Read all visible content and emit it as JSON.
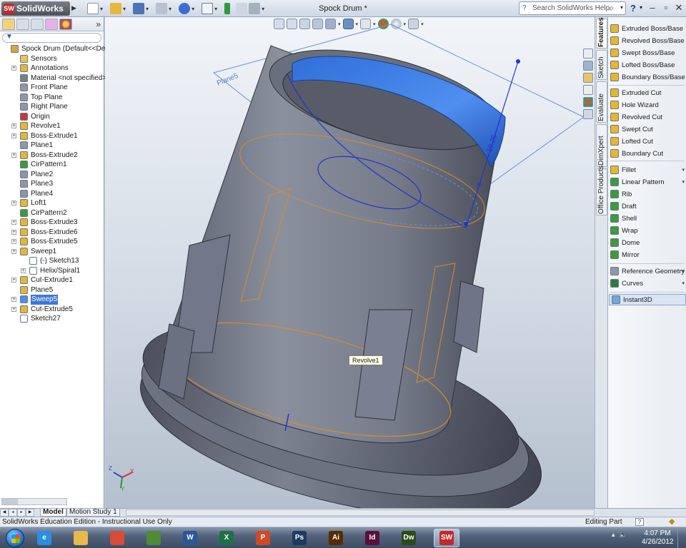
{
  "app": {
    "logo_text": "SolidWorks",
    "logo_badge": "SW",
    "window_title": "Spock Drum *",
    "help_search_placeholder": "Search SolidWorks Help",
    "help_symbol": "?"
  },
  "tree": {
    "more_glyph": "»",
    "items": [
      {
        "label": "Spock Drum  (Default<<Default",
        "icon": "part-icon",
        "indent": 0,
        "expandable": false,
        "selected": false,
        "color": "#d8a73a"
      },
      {
        "label": "Sensors",
        "icon": "sensor-icon",
        "indent": 1,
        "expandable": false,
        "selected": false,
        "color": "#e8c35a"
      },
      {
        "label": "Annotations",
        "icon": "annotation-icon",
        "indent": 1,
        "expandable": true,
        "selected": false,
        "color": "#e0b53d"
      },
      {
        "label": "Material <not specified>",
        "icon": "material-icon",
        "indent": 1,
        "expandable": false,
        "selected": false,
        "color": "#7a7f87"
      },
      {
        "label": "Front Plane",
        "icon": "plane-icon",
        "indent": 1,
        "expandable": false,
        "selected": false,
        "color": "#8d98a6"
      },
      {
        "label": "Top Plane",
        "icon": "plane-icon",
        "indent": 1,
        "expandable": false,
        "selected": false,
        "color": "#8d98a6"
      },
      {
        "label": "Right Plane",
        "icon": "plane-icon",
        "indent": 1,
        "expandable": false,
        "selected": false,
        "color": "#8d98a6"
      },
      {
        "label": "Origin",
        "icon": "origin-icon",
        "indent": 1,
        "expandable": false,
        "selected": false,
        "color": "#c33b3b"
      },
      {
        "label": "Revolve1",
        "icon": "revolve-icon",
        "indent": 1,
        "expandable": true,
        "selected": false,
        "color": "#e5b630"
      },
      {
        "label": "Boss-Extrude1",
        "icon": "extrude-icon",
        "indent": 1,
        "expandable": true,
        "selected": false,
        "color": "#e5b630"
      },
      {
        "label": "Plane1",
        "icon": "plane-icon",
        "indent": 1,
        "expandable": false,
        "selected": false,
        "color": "#8d98a6"
      },
      {
        "label": "Boss-Extrude2",
        "icon": "extrude-icon",
        "indent": 1,
        "expandable": true,
        "selected": false,
        "color": "#e5b630"
      },
      {
        "label": "CirPattern1",
        "icon": "circular-pattern-icon",
        "indent": 1,
        "expandable": false,
        "selected": false,
        "color": "#3d9a3d"
      },
      {
        "label": "Plane2",
        "icon": "plane-icon",
        "indent": 1,
        "expandable": false,
        "selected": false,
        "color": "#8d98a6"
      },
      {
        "label": "Plane3",
        "icon": "plane-icon",
        "indent": 1,
        "expandable": false,
        "selected": false,
        "color": "#8d98a6"
      },
      {
        "label": "Plane4",
        "icon": "plane-icon",
        "indent": 1,
        "expandable": false,
        "selected": false,
        "color": "#8d98a6"
      },
      {
        "label": "Loft1",
        "icon": "loft-icon",
        "indent": 1,
        "expandable": true,
        "selected": false,
        "color": "#e5b630"
      },
      {
        "label": "CirPattern2",
        "icon": "circular-pattern-icon",
        "indent": 1,
        "expandable": false,
        "selected": false,
        "color": "#3d9a3d"
      },
      {
        "label": "Boss-Extrude3",
        "icon": "extrude-icon",
        "indent": 1,
        "expandable": true,
        "selected": false,
        "color": "#e5b630"
      },
      {
        "label": "Boss-Extrude6",
        "icon": "extrude-icon",
        "indent": 1,
        "expandable": true,
        "selected": false,
        "color": "#e5b630"
      },
      {
        "label": "Boss-Extrude5",
        "icon": "extrude-icon",
        "indent": 1,
        "expandable": true,
        "selected": false,
        "color": "#e5b630"
      },
      {
        "label": "Sweep1",
        "icon": "sweep-icon",
        "indent": 1,
        "expandable": true,
        "selected": false,
        "color": "#e5b630"
      },
      {
        "label": "(-) Sketch13",
        "icon": "sketch-icon",
        "indent": 2,
        "expandable": false,
        "selected": false,
        "color": "#ffffff"
      },
      {
        "label": "Helix/Spiral1",
        "icon": "helix-icon",
        "indent": 2,
        "expandable": true,
        "selected": false,
        "color": "#ffffff"
      },
      {
        "label": "Cut-Extrude1",
        "icon": "cut-extrude-icon",
        "indent": 1,
        "expandable": true,
        "selected": false,
        "color": "#e5b630"
      },
      {
        "label": "Plane5",
        "icon": "plane-icon",
        "indent": 1,
        "expandable": false,
        "selected": false,
        "color": "#e0b53d"
      },
      {
        "label": "Sweep5",
        "icon": "sweep-icon",
        "indent": 1,
        "expandable": true,
        "selected": true,
        "color": "#4d8fe0"
      },
      {
        "label": "Cut-Extrude5",
        "icon": "cut-extrude-icon",
        "indent": 1,
        "expandable": true,
        "selected": false,
        "color": "#e5b630"
      },
      {
        "label": "Sketch27",
        "icon": "sketch-icon",
        "indent": 1,
        "expandable": false,
        "selected": false,
        "color": "#ffffff"
      }
    ]
  },
  "viewport": {
    "plane_label": "Plane5",
    "tooltip": "Revolve1",
    "dimension_1": "10.25",
    "dimension_2": "5",
    "triad": {
      "x": "X",
      "y": "Y",
      "z": "Z"
    }
  },
  "taskpane_tabs": [
    "Features",
    "Sketch",
    "Evaluate",
    "DimXpert",
    "Office Products"
  ],
  "features": [
    {
      "label": "Extruded Boss/Base",
      "icon": "extruded-boss-icon",
      "dropdown": false,
      "color": "#e5b630"
    },
    {
      "label": "Revolved Boss/Base",
      "icon": "revolved-boss-icon",
      "dropdown": false,
      "color": "#e5b630"
    },
    {
      "label": "Swept Boss/Base",
      "icon": "swept-boss-icon",
      "dropdown": false,
      "color": "#e5b630"
    },
    {
      "label": "Lofted Boss/Base",
      "icon": "lofted-boss-icon",
      "dropdown": false,
      "color": "#e5b630"
    },
    {
      "label": "Boundary Boss/Base",
      "icon": "boundary-boss-icon",
      "dropdown": false,
      "color": "#e5b630"
    },
    {
      "label": "Extruded Cut",
      "icon": "extruded-cut-icon",
      "dropdown": false,
      "color": "#e5b630"
    },
    {
      "label": "Hole Wizard",
      "icon": "hole-wizard-icon",
      "dropdown": false,
      "color": "#e5b630"
    },
    {
      "label": "Revolved Cut",
      "icon": "revolved-cut-icon",
      "dropdown": false,
      "color": "#e5b630"
    },
    {
      "label": "Swept Cut",
      "icon": "swept-cut-icon",
      "dropdown": false,
      "color": "#e5b630"
    },
    {
      "label": "Lofted Cut",
      "icon": "lofted-cut-icon",
      "dropdown": false,
      "color": "#e5b630"
    },
    {
      "label": "Boundary Cut",
      "icon": "boundary-cut-icon",
      "dropdown": false,
      "color": "#e5b630"
    },
    {
      "label": "Fillet",
      "icon": "fillet-icon",
      "dropdown": true,
      "color": "#e5b630"
    },
    {
      "label": "Linear Pattern",
      "icon": "linear-pattern-icon",
      "dropdown": true,
      "color": "#3d9a3d"
    },
    {
      "label": "Rib",
      "icon": "rib-icon",
      "dropdown": false,
      "color": "#3d9a3d"
    },
    {
      "label": "Draft",
      "icon": "draft-icon",
      "dropdown": false,
      "color": "#3d9a3d"
    },
    {
      "label": "Shell",
      "icon": "shell-icon",
      "dropdown": false,
      "color": "#3d9a3d"
    },
    {
      "label": "Wrap",
      "icon": "wrap-icon",
      "dropdown": false,
      "color": "#3d9a3d"
    },
    {
      "label": "Dome",
      "icon": "dome-icon",
      "dropdown": false,
      "color": "#3d9a3d"
    },
    {
      "label": "Mirror",
      "icon": "mirror-icon",
      "dropdown": false,
      "color": "#3d9a3d"
    },
    {
      "label": "Reference Geometry",
      "icon": "reference-geometry-icon",
      "dropdown": true,
      "color": "#8d98a6"
    },
    {
      "label": "Curves",
      "icon": "curves-icon",
      "dropdown": true,
      "color": "#2f7a3a"
    },
    {
      "label": "Instant3D",
      "icon": "instant3d-icon",
      "dropdown": false,
      "color": "#6fa8dc",
      "highlighted": true
    }
  ],
  "bottom_tabs": [
    "Model",
    "Motion Study 1"
  ],
  "status": {
    "left": "SolidWorks Education Edition - Instructional Use Only",
    "mode": "Editing Part",
    "help": "?"
  },
  "taskbar": {
    "apps": [
      {
        "name": "internet-explorer-icon",
        "glyph": "e",
        "color": "#2a8fe0"
      },
      {
        "name": "file-explorer-icon",
        "glyph": "",
        "color": "#e8b84a"
      },
      {
        "name": "chrome-icon",
        "glyph": "",
        "color": "#d94a38"
      },
      {
        "name": "project-icon",
        "glyph": "",
        "color": "#4d8a3a"
      },
      {
        "name": "word-icon",
        "glyph": "W",
        "color": "#2b5797"
      },
      {
        "name": "excel-icon",
        "glyph": "X",
        "color": "#1e7145"
      },
      {
        "name": "powerpoint-icon",
        "glyph": "P",
        "color": "#d24726"
      },
      {
        "name": "photoshop-icon",
        "glyph": "Ps",
        "color": "#1e3a5f"
      },
      {
        "name": "illustrator-icon",
        "glyph": "Ai",
        "color": "#5a2a00"
      },
      {
        "name": "indesign-icon",
        "glyph": "Id",
        "color": "#5a0f3a"
      },
      {
        "name": "dreamweaver-icon",
        "glyph": "Dw",
        "color": "#2d4a1a"
      },
      {
        "name": "solidworks-taskbar-icon",
        "glyph": "SW",
        "color": "#c62828",
        "active": true
      }
    ],
    "time": "4:07 PM",
    "date": "4/26/2012"
  }
}
